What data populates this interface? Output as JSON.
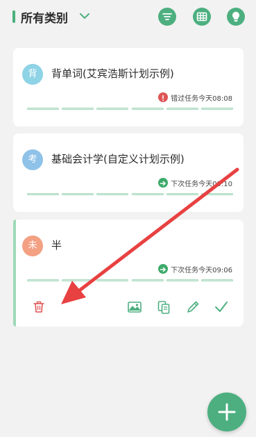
{
  "header": {
    "title": "所有类别",
    "icons": [
      "chevron-down-icon",
      "filter-icon",
      "grid-view-icon",
      "lightbulb-icon"
    ]
  },
  "cards": [
    {
      "avatar": "背",
      "avatar_color": "#8ed3e6",
      "title": "背单词(艾宾浩斯计划示例)",
      "status_icon": "alert-icon",
      "status_color": "#e05555",
      "status_text": "错过任务今天08:08"
    },
    {
      "avatar": "考",
      "avatar_color": "#8fc2e8",
      "title": "基础会计学(自定义计划示例)",
      "status_icon": "arrow-right-icon",
      "status_color": "#3eaa6a",
      "status_text": "下次任务今天09:10"
    },
    {
      "avatar": "未",
      "avatar_color": "#f3a083",
      "title": "半",
      "status_icon": "arrow-right-icon",
      "status_color": "#3eaa6a",
      "status_text": "下次任务今天09:06",
      "actions": [
        "trash-icon",
        "image-icon",
        "copy-icon",
        "pencil-icon",
        "check-icon"
      ]
    }
  ],
  "fab": {
    "icon": "plus-icon"
  },
  "colors": {
    "accent": "#4daf80",
    "danger": "#e05555",
    "annotation_arrow": "#e84141"
  }
}
